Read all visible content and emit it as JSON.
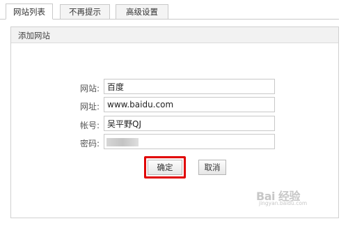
{
  "tabs": [
    {
      "label": "网站列表",
      "active": true
    },
    {
      "label": "不再提示",
      "active": false
    },
    {
      "label": "高级设置",
      "active": false
    }
  ],
  "panel": {
    "title": "添加网站"
  },
  "form": {
    "site_label": "网站:",
    "site_value": "百度",
    "url_label": "网址:",
    "url_value": "www.baidu.com",
    "account_label": "帐号:",
    "account_value": "吴平野QJ",
    "password_label": "密码:"
  },
  "buttons": {
    "ok_label": "确定",
    "cancel_label": "取消"
  },
  "watermark": {
    "logo": "Bai 经验",
    "url": "jingyan.baidu.com"
  },
  "colors": {
    "highlight": "#e00000",
    "border": "#c9c9c9",
    "watermark": "#c7c7c7"
  }
}
